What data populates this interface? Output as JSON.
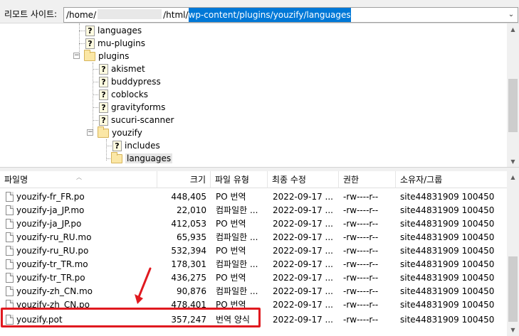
{
  "path_bar": {
    "label": "리모트 사이트:",
    "path_prefix": "/home/",
    "path_mid": "/html/",
    "path_selected": "wp-content/plugins/youzify/languages",
    "dropdown_icon": "chevron-down-icon"
  },
  "tree": {
    "items": [
      {
        "label": "languages",
        "icon": "unknown-folder-icon"
      },
      {
        "label": "mu-plugins",
        "icon": "unknown-folder-icon"
      },
      {
        "label": "plugins",
        "icon": "folder-icon",
        "expanded": true
      },
      {
        "label": "akismet",
        "icon": "unknown-folder-icon"
      },
      {
        "label": "buddypress",
        "icon": "unknown-folder-icon"
      },
      {
        "label": "coblocks",
        "icon": "unknown-folder-icon"
      },
      {
        "label": "gravityforms",
        "icon": "unknown-folder-icon"
      },
      {
        "label": "sucuri-scanner",
        "icon": "unknown-folder-icon"
      },
      {
        "label": "youzify",
        "icon": "folder-icon",
        "expanded": true
      },
      {
        "label": "includes",
        "icon": "unknown-folder-icon"
      },
      {
        "label": "languages",
        "icon": "folder-icon",
        "selected": true
      }
    ]
  },
  "file_list": {
    "columns": {
      "name": "파일명",
      "size": "크기",
      "type": "파일 유형",
      "modified": "최종 수정",
      "permissions": "권한",
      "owner": "소유자/그룹"
    },
    "rows": [
      {
        "name": "youzify-fr_FR.po",
        "size": "448,405",
        "type": "PO 번역",
        "modified": "2022-09-17 ...",
        "perm": "-rw----r--",
        "owner": "site44831909 100450"
      },
      {
        "name": "youzify-ja_JP.mo",
        "size": "22,010",
        "type": "컴파일한 ...",
        "modified": "2022-09-17 ...",
        "perm": "-rw----r--",
        "owner": "site44831909 100450"
      },
      {
        "name": "youzify-ja_JP.po",
        "size": "412,053",
        "type": "PO 번역",
        "modified": "2022-09-17 ...",
        "perm": "-rw----r--",
        "owner": "site44831909 100450"
      },
      {
        "name": "youzify-ru_RU.mo",
        "size": "65,935",
        "type": "컴파일한 ...",
        "modified": "2022-09-17 ...",
        "perm": "-rw----r--",
        "owner": "site44831909 100450"
      },
      {
        "name": "youzify-ru_RU.po",
        "size": "532,394",
        "type": "PO 번역",
        "modified": "2022-09-17 ...",
        "perm": "-rw----r--",
        "owner": "site44831909 100450"
      },
      {
        "name": "youzify-tr_TR.mo",
        "size": "178,301",
        "type": "컴파일한 ...",
        "modified": "2022-09-17 ...",
        "perm": "-rw----r--",
        "owner": "site44831909 100450"
      },
      {
        "name": "youzify-tr_TR.po",
        "size": "436,275",
        "type": "PO 번역",
        "modified": "2022-09-17 ...",
        "perm": "-rw----r--",
        "owner": "site44831909 100450"
      },
      {
        "name": "youzify-zh_CN.mo",
        "size": "90,876",
        "type": "컴파일한 ...",
        "modified": "2022-09-17 ...",
        "perm": "-rw----r--",
        "owner": "site44831909 100450"
      },
      {
        "name": "youzify-zh_CN.po",
        "size": "478,401",
        "type": "PO 번역",
        "modified": "2022-09-17 ...",
        "perm": "-rw----r--",
        "owner": "site44831909 100450"
      },
      {
        "name": "youzify.pot",
        "size": "357,247",
        "type": "번역 양식",
        "modified": "2022-09-17 ...",
        "perm": "-rw----r--",
        "owner": "site44831909 100450",
        "highlighted": true
      }
    ]
  },
  "colors": {
    "selection": "#0078d7",
    "highlight_box": "#e0191f",
    "folder": "#fbe7a6"
  }
}
